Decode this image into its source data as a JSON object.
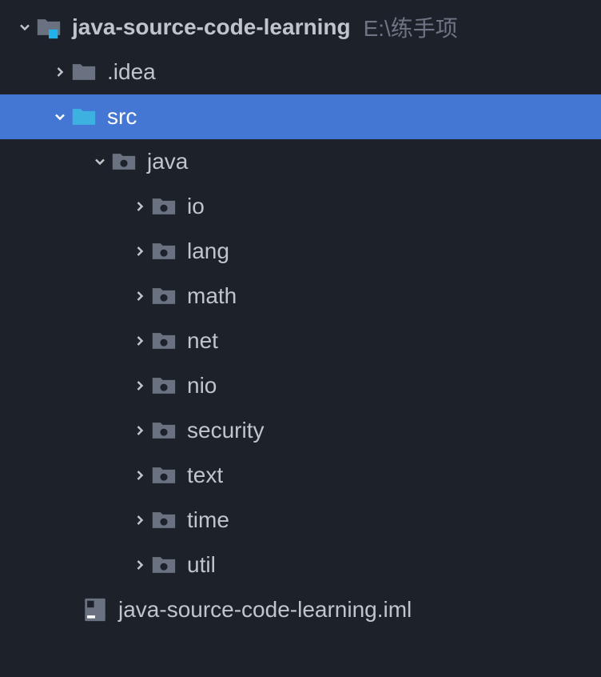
{
  "root": {
    "name": "java-source-code-learning",
    "path": "E:\\练手项"
  },
  "nodes": {
    "idea": ".idea",
    "src": "src",
    "java": "java",
    "io": "io",
    "lang": "lang",
    "math": "math",
    "net": "net",
    "nio": "nio",
    "security": "security",
    "text": "text",
    "time": "time",
    "util": "util",
    "iml": "java-source-code-learning.iml"
  }
}
